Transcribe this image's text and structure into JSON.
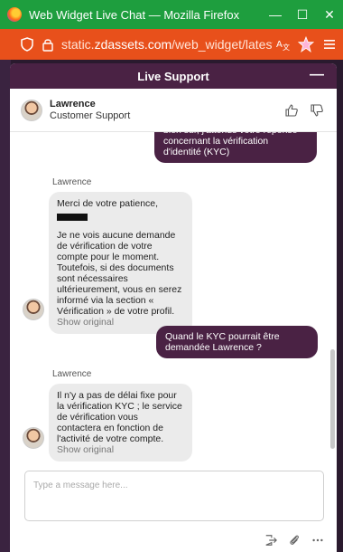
{
  "window": {
    "title": "Web Widget Live Chat — Mozilla Firefox",
    "min_glyph": "—",
    "max_glyph": "☐",
    "close_glyph": "✕"
  },
  "urlbar": {
    "url_prefix": "static.",
    "url_domain": "zdassets.com",
    "url_rest": "/web_widget/latest/"
  },
  "widget": {
    "header_title": "Live Support",
    "minimize_glyph": "—",
    "agent": {
      "name": "Lawrence",
      "role": "Customer Support"
    },
    "messages": {
      "user_1": "bien sûr, j'attends votre réponse concernant la vérification d'identité (KYC)",
      "agent_1_sender": "Lawrence",
      "agent_1_line1": "Merci de votre patience,",
      "agent_1_body": "Je ne vois aucune demande de vérification de votre compte pour le moment. Toutefois, si des documents sont nécessaires ultérieurement, vous en serez informé via la section « Vérification » de votre profil.",
      "agent_1_show_original": "Show original",
      "user_2": "Quand le KYC pourrait être demandée Lawrence ?",
      "agent_2_sender": "Lawrence",
      "agent_2_body": "Il n'y a pas de délai fixe pour la vérification KYC ; le service de vérification vous contactera en fonction de l'activité de votre compte.",
      "agent_2_show_original": "Show original"
    },
    "composer_placeholder": "Type a message here..."
  },
  "colors": {
    "titlebar": "#1e9e3e",
    "urlbar": "#e8501b",
    "brand": "#4a2244",
    "agent_bubble": "#ebebeb"
  },
  "icons": [
    "firefox-logo",
    "shield-icon",
    "lock-icon",
    "translate-icon",
    "extension-icon",
    "menu-icon",
    "thumbs-up-icon",
    "thumbs-down-icon",
    "attachment-icon",
    "end-chat-icon",
    "more-icon"
  ]
}
